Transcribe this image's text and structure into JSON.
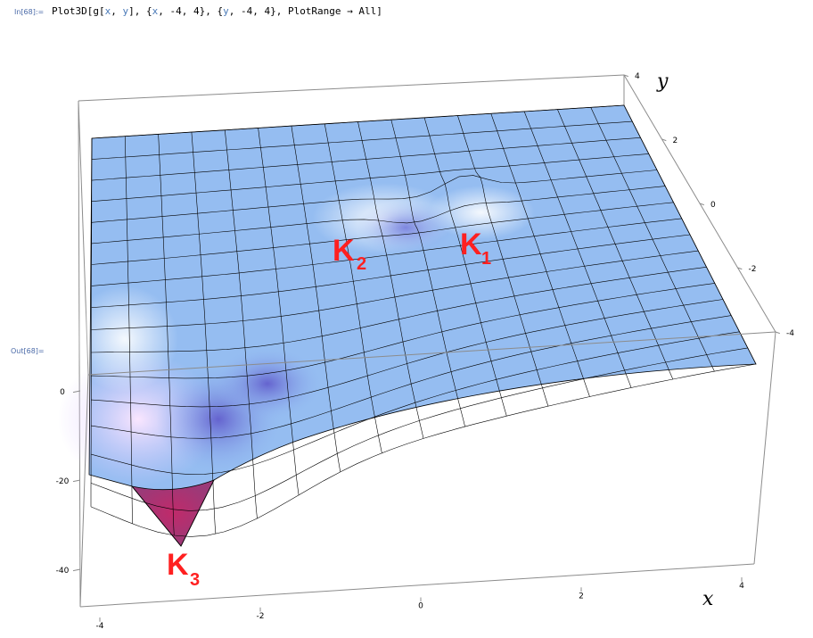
{
  "notebook": {
    "input_label": "In[68]:=",
    "input_code": [
      {
        "t": "Plot3D[g[",
        "c": "k"
      },
      {
        "t": "x",
        "c": "v"
      },
      {
        "t": ", ",
        "c": "k"
      },
      {
        "t": "y",
        "c": "v"
      },
      {
        "t": "], {",
        "c": "k"
      },
      {
        "t": "x",
        "c": "v"
      },
      {
        "t": ", -4, 4}, {",
        "c": "k"
      },
      {
        "t": "y",
        "c": "v"
      },
      {
        "t": ", -4, 4}, PlotRange → All]",
        "c": "k"
      }
    ],
    "output_label": "Out[68]="
  },
  "chart_data": {
    "type": "surface3d",
    "function": "g[x, y]",
    "x_range": [
      -4,
      4
    ],
    "y_range": [
      -4,
      4
    ],
    "plot_range": "All",
    "xlabel": "x",
    "ylabel": "y",
    "x_ticks": [
      "-4",
      "-2",
      "0",
      "2",
      "4"
    ],
    "y_ticks": [
      "-4",
      "-2",
      "0",
      "2",
      "4"
    ],
    "z_ticks": [
      "0",
      "-20",
      "-40"
    ],
    "colors": {
      "surface": "#8fb8f0",
      "mesh": "#000000",
      "box": "#8c8c8c",
      "label": "#ff2020"
    },
    "annotations": [
      {
        "main": "K",
        "sub": "1"
      },
      {
        "main": "K",
        "sub": "2"
      },
      {
        "main": "K",
        "sub": "3"
      }
    ],
    "critical_points": [
      {
        "name": "K1",
        "x": 1,
        "y": 0,
        "z": 0
      },
      {
        "name": "K2",
        "x": 0,
        "y": 0.6,
        "z": -3
      },
      {
        "name": "K3",
        "x": -2.3,
        "y": -3.2,
        "z": -35
      }
    ]
  }
}
